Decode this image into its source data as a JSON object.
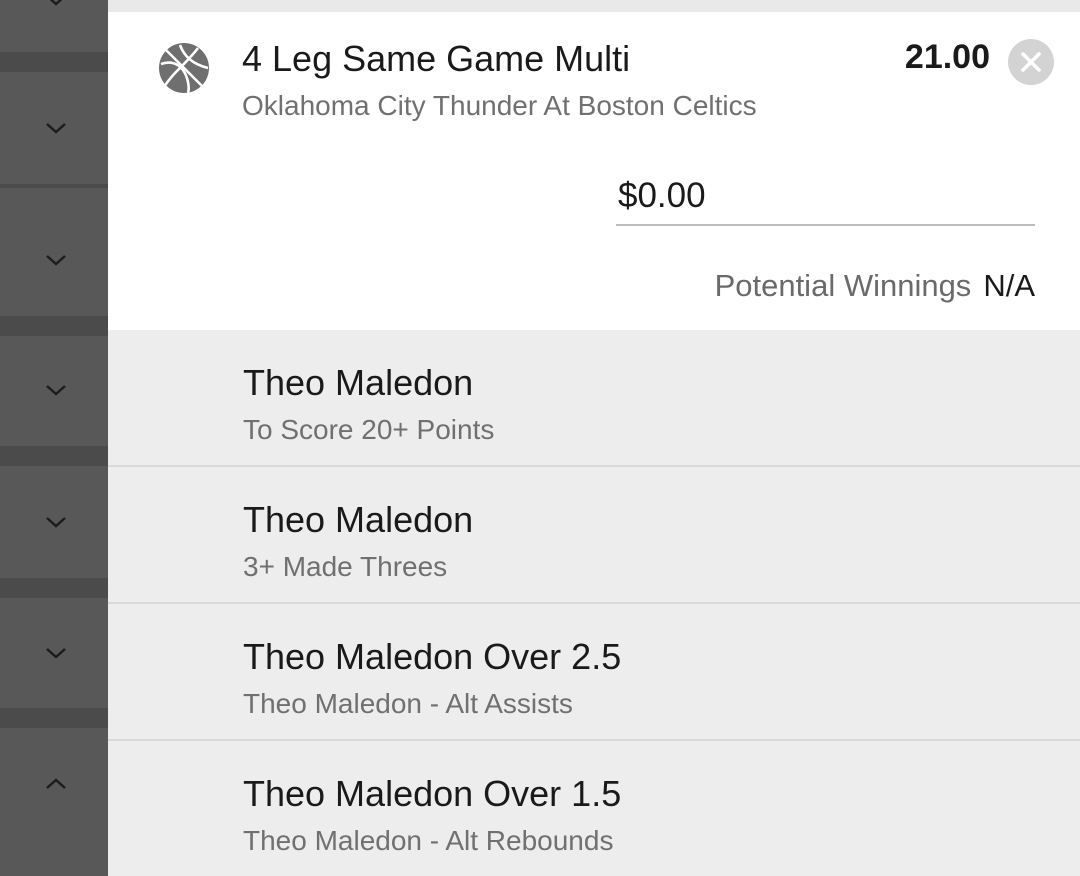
{
  "bet": {
    "title": "4 Leg Same Game Multi",
    "subtitle": "Oklahoma City Thunder At Boston Celtics",
    "odds": "21.00",
    "sport_icon": "basketball-icon",
    "stake_value": "$0.00",
    "potential_winnings_label": "Potential Winnings",
    "potential_winnings_value": "N/A"
  },
  "legs": [
    {
      "title": "Theo Maledon",
      "subtitle": "To Score 20+ Points"
    },
    {
      "title": "Theo Maledon",
      "subtitle": "3+ Made Threes"
    },
    {
      "title": "Theo Maledon Over 2.5",
      "subtitle": "Theo Maledon - Alt Assists"
    },
    {
      "title": "Theo Maledon Over 1.5",
      "subtitle": "Theo Maledon - Alt Rebounds"
    }
  ],
  "rail": {
    "chevrons": [
      "chevron-down-icon",
      "chevron-down-icon",
      "chevron-down-icon",
      "chevron-down-icon",
      "chevron-down-icon",
      "chevron-down-icon",
      "chevron-down-icon",
      "chevron-up-icon"
    ]
  },
  "colors": {
    "panel_bg": "#ffffff",
    "legs_bg": "#ededed",
    "rail_bg": "#595959",
    "text_primary": "#1a1a1a",
    "text_secondary": "#707070"
  }
}
